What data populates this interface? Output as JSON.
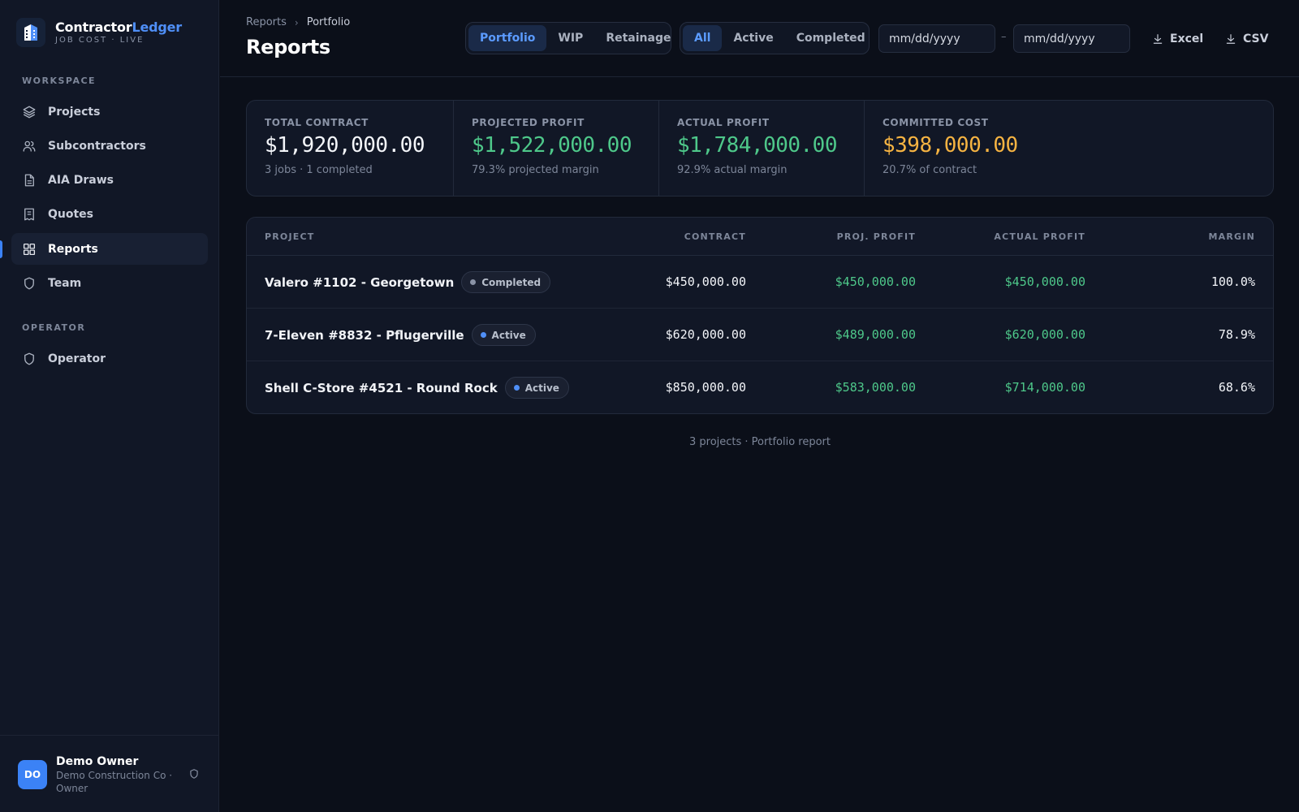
{
  "brand": {
    "name_main": "Contractor",
    "name_accent": "Ledger",
    "subtitle": "JOB COST · LIVE"
  },
  "sidebar": {
    "workspace_label": "WORKSPACE",
    "items": [
      {
        "label": "Projects",
        "icon": "layers-icon"
      },
      {
        "label": "Subcontractors",
        "icon": "users-icon"
      },
      {
        "label": "AIA Draws",
        "icon": "document-icon"
      },
      {
        "label": "Quotes",
        "icon": "receipt-icon"
      },
      {
        "label": "Reports",
        "icon": "grid-icon",
        "active": true
      },
      {
        "label": "Team",
        "icon": "shield-icon"
      }
    ],
    "operator_label": "OPERATOR",
    "operator_item": {
      "label": "Operator",
      "icon": "shield-icon"
    }
  },
  "user": {
    "initials": "DO",
    "name": "Demo Owner",
    "org": "Demo Construction Co · Owner"
  },
  "header": {
    "breadcrumb": [
      "Reports",
      "Portfolio"
    ],
    "title": "Reports",
    "report_tabs": [
      "Portfolio",
      "WIP",
      "Retainage"
    ],
    "active_report_tab": "Portfolio",
    "status_filters": [
      "All",
      "Active",
      "Completed"
    ],
    "active_status_filter": "All",
    "date_from_placeholder": "mm/dd/yyyy",
    "date_to_placeholder": "mm/dd/yyyy",
    "date_separator": "–",
    "export_excel": "Excel",
    "export_csv": "CSV"
  },
  "stats": [
    {
      "label": "TOTAL CONTRACT",
      "value": "$1,920,000.00",
      "sub": "3 jobs · 1 completed",
      "color": "#f3f5f9"
    },
    {
      "label": "PROJECTED PROFIT",
      "value": "$1,522,000.00",
      "sub": "79.3% projected margin",
      "color": "#4ec88a"
    },
    {
      "label": "ACTUAL PROFIT",
      "value": "$1,784,000.00",
      "sub": "92.9% actual margin",
      "color": "#4ec88a"
    },
    {
      "label": "COMMITTED COST",
      "value": "$398,000.00",
      "sub": "20.7% of contract",
      "color": "#f5b342"
    }
  ],
  "table": {
    "columns": [
      "PROJECT",
      "CONTRACT",
      "PROJ. PROFIT",
      "ACTUAL PROFIT",
      "MARGIN"
    ],
    "rows": [
      {
        "project": "Valero #1102 - Georgetown",
        "status": "Completed",
        "contract": "$450,000.00",
        "proj_profit": "$450,000.00",
        "actual_profit": "$450,000.00",
        "margin": "100.0%"
      },
      {
        "project": "7-Eleven #8832 - Pflugerville",
        "status": "Active",
        "contract": "$620,000.00",
        "proj_profit": "$489,000.00",
        "actual_profit": "$620,000.00",
        "margin": "78.9%"
      },
      {
        "project": "Shell C-Store #4521 - Round Rock",
        "status": "Active",
        "contract": "$850,000.00",
        "proj_profit": "$583,000.00",
        "actual_profit": "$714,000.00",
        "margin": "68.6%"
      }
    ]
  },
  "footer_note": "3 projects · Portfolio report",
  "colors": {
    "accent": "#3b82f6",
    "profit": "#4ec88a",
    "cost": "#f5b342",
    "background": "#0b0f19",
    "panel": "#111726"
  }
}
